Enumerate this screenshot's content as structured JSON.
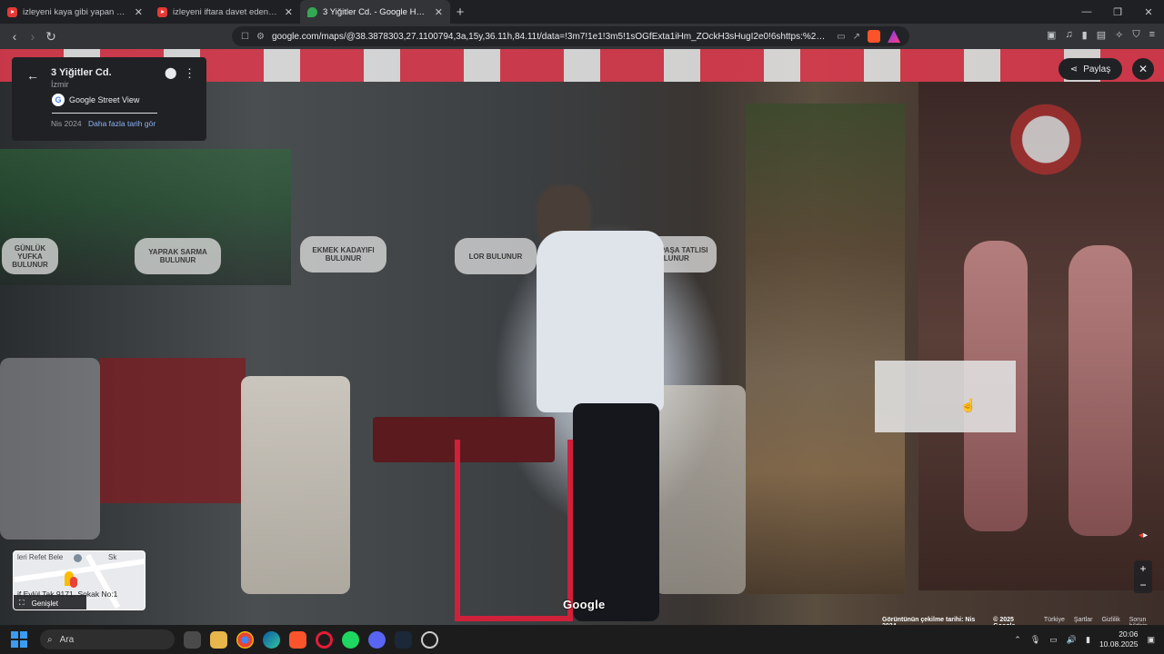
{
  "browser": {
    "tabs": [
      {
        "title": "izleyeni kaya gibi yapan kick komik a",
        "favicon": "youtube-icon",
        "active": false
      },
      {
        "title": "izleyeni iftara davet eden kick komik",
        "favicon": "youtube-icon",
        "active": false
      },
      {
        "title": "3 Yiğitler Cd. - Google Haritalar",
        "favicon": "google-maps-icon",
        "active": true
      }
    ],
    "url": "google.com/maps/@38.3878303,27.1100794,3a,15y,36.11h,84.11t/data=!3m7!1e1!3m5!1sOGfExta1iHm_ZOckH3sHugI2e0!6shttps:%2F%2Fstree..."
  },
  "infocard": {
    "title": "3 Yiğitler Cd.",
    "city": "İzmir",
    "source_label": "Google Street View",
    "date": "Nis 2024",
    "more_dates_link": "Daha fazla tarih gör"
  },
  "controls": {
    "share_label": "Paylaş",
    "zoom_in": "+",
    "zoom_out": "−"
  },
  "scene_signs": [
    {
      "text": "GÜNLÜK YUFKA BULUNUR"
    },
    {
      "text": "YAPRAK SARMA BULUNUR"
    },
    {
      "text": "EKMEK KADAYIFI BULUNUR"
    },
    {
      "text": "LOR BULUNUR"
    },
    {
      "text": "KEMALPAŞA TATLISI BULUNUR"
    }
  ],
  "minimap": {
    "label_top": "leri Refet Bele",
    "label_top_right": "Sk",
    "label_bottom": "if Eylül Tak  9171. Sokak No:1",
    "expand_label": "Genişlet"
  },
  "watermark": "Google",
  "footer": {
    "capture_date": "Görüntünün çekilme tarihi: Nis 2024",
    "copyright": "© 2025 Google",
    "country": "Türkiye",
    "terms": "Şartlar",
    "privacy": "Gizlilik",
    "report": "Sorun bildirin"
  },
  "taskbar": {
    "search_placeholder": "Ara",
    "time": "20:06",
    "date": "10.08.2025"
  },
  "colors": {
    "accent_link": "#8ab4f8",
    "card_bg": "#202124",
    "awning_red": "#e23a4e"
  }
}
